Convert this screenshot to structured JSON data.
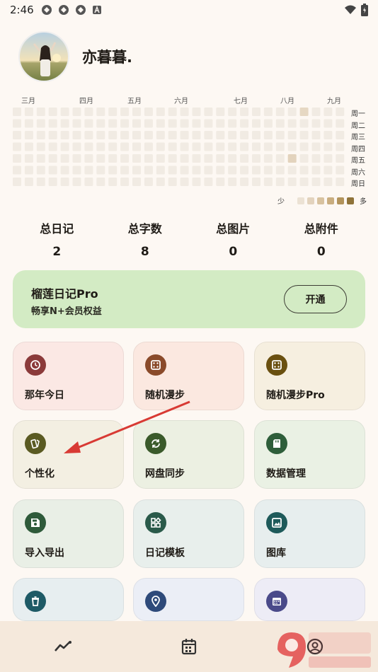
{
  "status_bar": {
    "time": "2:46",
    "icons": [
      "app-icon-1",
      "app-icon-2",
      "app-icon-3",
      "a-badge-icon"
    ],
    "right_icons": [
      "wifi-icon",
      "battery-icon"
    ]
  },
  "profile": {
    "username": "亦暮暮."
  },
  "heatmap": {
    "months": [
      "三月",
      "四月",
      "五月",
      "六月",
      "七月",
      "八月",
      "九月"
    ],
    "days": [
      "周一",
      "周二",
      "周三",
      "周四",
      "周五",
      "周六",
      "周日"
    ],
    "legend_less": "少",
    "legend_more": "多",
    "legend_colors": [
      "#ece2d4",
      "#e3d3bd",
      "#d8c29f",
      "#c9ad7f",
      "#b2935b",
      "#8f7339"
    ]
  },
  "stats": [
    {
      "label": "总日记",
      "value": "2"
    },
    {
      "label": "总字数",
      "value": "8"
    },
    {
      "label": "总图片",
      "value": "0"
    },
    {
      "label": "总附件",
      "value": "0"
    }
  ],
  "pro": {
    "title": "榴莲日记Pro",
    "subtitle": "畅享N+会员权益",
    "button": "开通",
    "bg": "#d3ebc4"
  },
  "tiles": [
    {
      "label": "那年今日",
      "icon": "clock-icon",
      "bg": "#fbe8e4",
      "icon_bg": "#8b3a3a"
    },
    {
      "label": "随机漫步",
      "icon": "dice-icon",
      "bg": "#fbe8e0",
      "icon_bg": "#8a4a2a"
    },
    {
      "label": "随机漫步Pro",
      "icon": "dice-icon",
      "bg": "#f6efe0",
      "icon_bg": "#6a5010"
    },
    {
      "label": "个性化",
      "icon": "palette-icon",
      "bg": "#f3efe2",
      "icon_bg": "#5a5a22"
    },
    {
      "label": "网盘同步",
      "icon": "sync-icon",
      "bg": "#ecf0e2",
      "icon_bg": "#3a5a2a"
    },
    {
      "label": "数据管理",
      "icon": "sd-card-icon",
      "bg": "#eaf1e4",
      "icon_bg": "#2e5e3a"
    },
    {
      "label": "导入导出",
      "icon": "save-icon",
      "bg": "#e9efe6",
      "icon_bg": "#2e5a3a"
    },
    {
      "label": "日记模板",
      "icon": "widgets-icon",
      "bg": "#e8efec",
      "icon_bg": "#2a5a4a"
    },
    {
      "label": "图库",
      "icon": "image-icon",
      "bg": "#e7eeee",
      "icon_bg": "#1e5a5a"
    },
    {
      "label": "",
      "icon": "trash-icon",
      "bg": "#e7eef0",
      "icon_bg": "#1e5a66"
    },
    {
      "label": "",
      "icon": "location-icon",
      "bg": "#ebeef6",
      "icon_bg": "#2e4a7a"
    },
    {
      "label": "",
      "icon": "calendar-icon",
      "bg": "#edecf6",
      "icon_bg": "#4a4a8a"
    }
  ],
  "bottom_nav": [
    {
      "icon": "trend-icon"
    },
    {
      "icon": "calendar-icon"
    },
    {
      "icon": "profile-icon"
    }
  ]
}
